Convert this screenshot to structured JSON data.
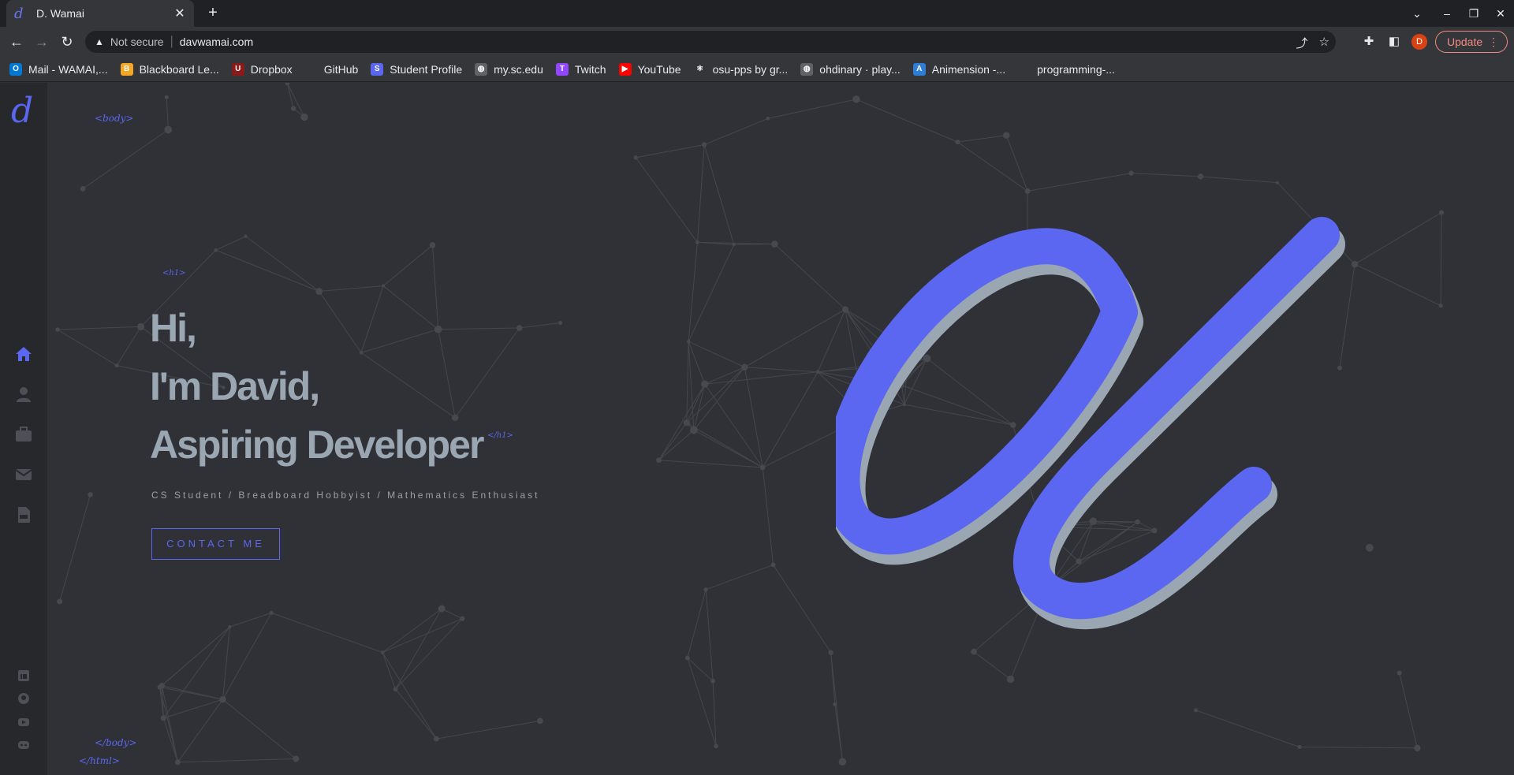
{
  "browser": {
    "tab_title": "D. Wamai",
    "tab_favicon": "d",
    "new_tab": "+",
    "security_label": "Not secure",
    "url": "davwamai.com",
    "update_label": "Update",
    "profile_initial": "D",
    "bookmarks": [
      {
        "label": "Mail - WAMAI,...",
        "icon": "outlook-icon",
        "color": "#0078d4",
        "glyph": "O"
      },
      {
        "label": "Blackboard Le...",
        "icon": "blackboard-icon",
        "color": "#f5a623",
        "glyph": "B"
      },
      {
        "label": "Dropbox",
        "icon": "dropbox-icon",
        "color": "#8b1a1a",
        "glyph": "U"
      },
      {
        "label": "GitHub",
        "icon": "github-icon",
        "color": "#35363a",
        "glyph": ""
      },
      {
        "label": "Student Profile",
        "icon": "student-profile-icon",
        "color": "#5b67f0",
        "glyph": "S"
      },
      {
        "label": "my.sc.edu",
        "icon": "globe-icon",
        "color": "#5f6368",
        "glyph": "◍"
      },
      {
        "label": "Twitch",
        "icon": "twitch-icon",
        "color": "#9146ff",
        "glyph": "T"
      },
      {
        "label": "YouTube",
        "icon": "youtube-icon",
        "color": "#ff0000",
        "glyph": "▶"
      },
      {
        "label": "osu-pps by gr...",
        "icon": "react-icon",
        "color": "#35363a",
        "glyph": "⚛"
      },
      {
        "label": "ohdinary · play...",
        "icon": "globe-icon",
        "color": "#5f6368",
        "glyph": "◍"
      },
      {
        "label": "Animension -...",
        "icon": "animension-icon",
        "color": "#2e7dd7",
        "glyph": "A"
      },
      {
        "label": "programming-...",
        "icon": "github-icon",
        "color": "#35363a",
        "glyph": ""
      }
    ]
  },
  "site": {
    "logo": "d",
    "tags": {
      "body_open": "<body>",
      "h1_open": "<h1>",
      "h1_close": "</h1>",
      "body_close": "</body>",
      "html_close": "</html>"
    },
    "hero": {
      "line1": "Hi,",
      "line2": "I'm David,",
      "line3": "Aspiring Developer"
    },
    "subtitle": "CS Student / Breadboard Hobbyist / Mathematics Enthusiast",
    "contact_label": "CONTACT ME",
    "nav": [
      "home-icon",
      "user-icon",
      "briefcase-icon",
      "envelope-icon",
      "pdf-icon"
    ],
    "social": [
      "linkedin-icon",
      "github-icon",
      "youtube-icon",
      "discord-icon"
    ],
    "accent": "#5b67f0"
  }
}
